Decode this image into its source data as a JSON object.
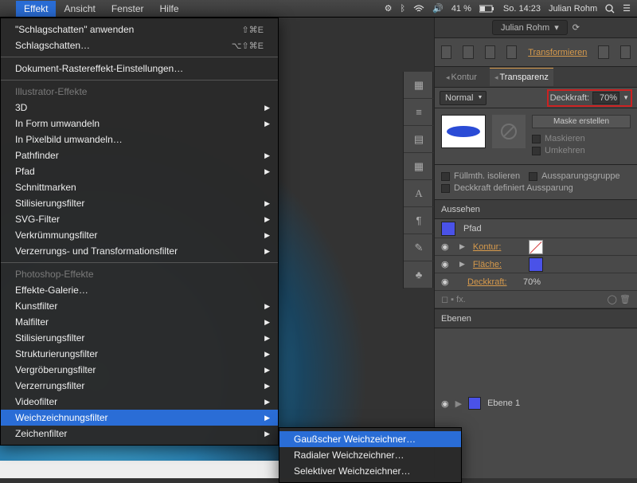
{
  "menubar": {
    "menus": [
      "Effekt",
      "Ansicht",
      "Fenster",
      "Hilfe"
    ],
    "active": 0,
    "status": {
      "battery": "41 %",
      "clock": "So. 14:23",
      "user": "Julian Rohm"
    }
  },
  "dropdown": {
    "items": [
      {
        "label": "\"Schlagschatten\" anwenden",
        "shortcut": "⇧⌘E"
      },
      {
        "label": "Schlagschatten…",
        "shortcut": "⌥⇧⌘E"
      },
      {
        "divider": true
      },
      {
        "label": "Dokument-Rastereffekt-Einstellungen…"
      },
      {
        "divider": true
      },
      {
        "label": "Illustrator-Effekte",
        "disabled": true
      },
      {
        "label": "3D",
        "sub": true
      },
      {
        "label": "In Form umwandeln",
        "sub": true
      },
      {
        "label": "In Pixelbild umwandeln…"
      },
      {
        "label": "Pathfinder",
        "sub": true
      },
      {
        "label": "Pfad",
        "sub": true
      },
      {
        "label": "Schnittmarken"
      },
      {
        "label": "Stilisierungsfilter",
        "sub": true
      },
      {
        "label": "SVG-Filter",
        "sub": true
      },
      {
        "label": "Verkrümmungsfilter",
        "sub": true
      },
      {
        "label": "Verzerrungs- und Transformationsfilter",
        "sub": true
      },
      {
        "divider": true
      },
      {
        "label": "Photoshop-Effekte",
        "disabled": true
      },
      {
        "label": "Effekte-Galerie…"
      },
      {
        "label": "Kunstfilter",
        "sub": true
      },
      {
        "label": "Malfilter",
        "sub": true
      },
      {
        "label": "Stilisierungsfilter",
        "sub": true
      },
      {
        "label": "Strukturierungsfilter",
        "sub": true
      },
      {
        "label": "Vergröberungsfilter",
        "sub": true
      },
      {
        "label": "Verzerrungsfilter",
        "sub": true
      },
      {
        "label": "Videofilter",
        "sub": true
      },
      {
        "label": "Weichzeichnungsfilter",
        "sub": true,
        "highlight": true
      },
      {
        "label": "Zeichenfilter",
        "sub": true
      }
    ]
  },
  "submenu": {
    "items": [
      {
        "label": "Gaußscher Weichzeichner…",
        "highlight": true
      },
      {
        "label": "Radialer Weichzeichner…"
      },
      {
        "label": "Selektiver Weichzeichner…"
      }
    ]
  },
  "titlebar": {
    "user": "Julian Rohm"
  },
  "toolbar": {
    "transform": "Transformieren"
  },
  "transparency": {
    "tabs": [
      "Kontur",
      "Transparenz"
    ],
    "active": 1,
    "mode": "Normal",
    "opacity_label": "Deckkraft:",
    "opacity": "70%",
    "mask_button": "Maske erstellen",
    "mask_chk1": "Maskieren",
    "mask_chk2": "Umkehren",
    "opt1": "Füllmth. isolieren",
    "opt2": "Aussparungsgruppe",
    "opt3": "Deckkraft definiert Aussparung"
  },
  "aussehen": {
    "title": "Aussehen",
    "pfad": "Pfad",
    "rows": [
      {
        "label": "Kontur:",
        "swatch": "none"
      },
      {
        "label": "Fläche:",
        "swatch": "fill"
      },
      {
        "label": "Deckkraft:",
        "val": "70%"
      }
    ]
  },
  "ebenen": {
    "title": "Ebenen",
    "layer": "Ebene 1"
  }
}
